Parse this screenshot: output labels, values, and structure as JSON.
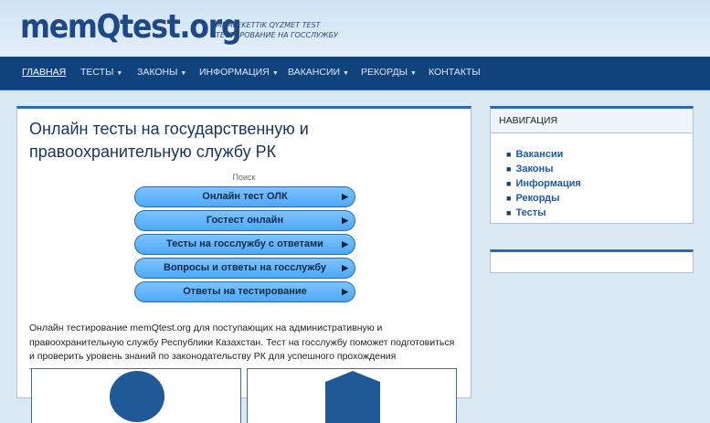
{
  "header": {
    "logo": "memQtest.org",
    "tagline_1": "MEMLEKETTIK QYZMET TEST",
    "tagline_2": "ТЕСТИРОВАНИЕ НА ГОССЛУЖБУ"
  },
  "nav": {
    "items": [
      {
        "label": "Главная",
        "active": true,
        "dropdown": false
      },
      {
        "label": "Тесты",
        "dropdown": true
      },
      {
        "label": "Законы",
        "dropdown": true
      },
      {
        "label": "Информация",
        "dropdown": true
      },
      {
        "label": "Вакансии",
        "dropdown": true
      },
      {
        "label": "Рекорды",
        "dropdown": true
      },
      {
        "label": "Контакты",
        "dropdown": false
      }
    ],
    "caret": "▼"
  },
  "main": {
    "title": "Онлайн тесты на государственную и правоохранительную службу РК",
    "search_label": "Поиск",
    "buttons": [
      {
        "label": "Онлайн тест ОЛК"
      },
      {
        "label": "Гостест онлайн"
      },
      {
        "label": "Тесты на госслужбу с ответами"
      },
      {
        "label": "Вопросы и ответы на госслужбу"
      },
      {
        "label": "Ответы на тестирование"
      }
    ],
    "arrow": "▶",
    "description": "Онлайн тестирование memQtest.org для поступающих на административную и правоохранительную службу Республики Казахстан. Тест на госслужбу поможет подготовиться и проверить уровень знаний по законодательству РК для успешного прохождения тестирования."
  },
  "sidebar": {
    "heading": "Навигация",
    "bullet": "■",
    "links": [
      "Вакансии",
      "Законы",
      "Информация",
      "Рекорды",
      "Тесты"
    ]
  },
  "colors": {
    "navbar": "#10427d",
    "logo": "#1d4a86",
    "button": "#4ea8f6",
    "link": "#1d5aa8"
  }
}
